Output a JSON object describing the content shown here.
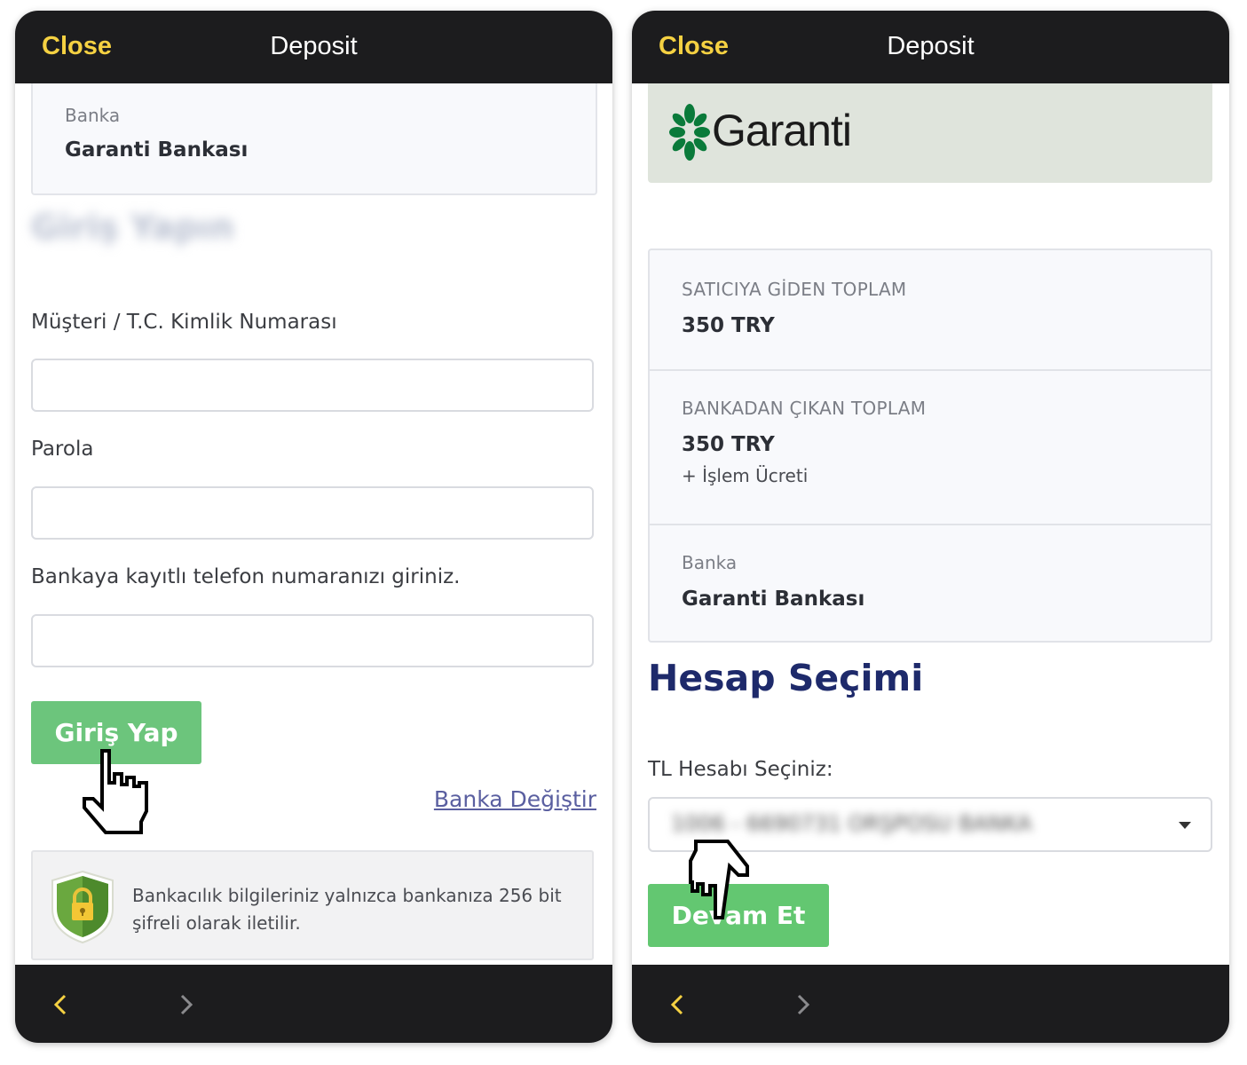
{
  "left": {
    "topbar": {
      "close_label": "Close",
      "title": "Deposit"
    },
    "bank_card": {
      "label": "Banka",
      "value": "Garanti Bankası"
    },
    "blurred_heading": "Giriş Yapın",
    "fields": {
      "customer_id_label": "Müşteri / T.C. Kimlik Numarası",
      "password_label": "Parola",
      "phone_label": "Bankaya kayıtlı telefon numaranızı giriniz."
    },
    "login_button": "Giriş Yap",
    "change_bank_link": "Banka Değiştir",
    "security_note": "Bankacılık bilgileriniz yalnızca bankanıza 256 bit şifreli olarak iletilir."
  },
  "right": {
    "topbar": {
      "close_label": "Close",
      "title": "Deposit"
    },
    "bank_logo_text": "Garanti",
    "summary": {
      "merchant_total_label": "SATICIYA GİDEN TOPLAM",
      "merchant_total_value": "350 TRY",
      "bank_total_label": "BANKADAN ÇIKAN TOPLAM",
      "bank_total_value": "350 TRY",
      "fee_note": "+ İşlem Ücreti",
      "bank_label": "Banka",
      "bank_value": "Garanti Bankası"
    },
    "section_heading": "Hesap Seçimi",
    "account_select_label": "TL Hesabı Seçiniz:",
    "account_select_value": "1006 - 6690731 ORŞPOSU BANKA",
    "continue_button": "Devam Et"
  },
  "colors": {
    "bar_bg": "#1c1c1e",
    "close_accent": "#f5d142",
    "button_green": "#6cc57c",
    "heading_navy": "#1e2a6b",
    "link_color": "#5a5fa0"
  },
  "icons": {
    "back": "chevron-left-icon",
    "forward": "chevron-right-icon",
    "shield": "shield-lock-icon",
    "cursor": "hand-pointer-icon",
    "logo": "garanti-clover-logo"
  }
}
